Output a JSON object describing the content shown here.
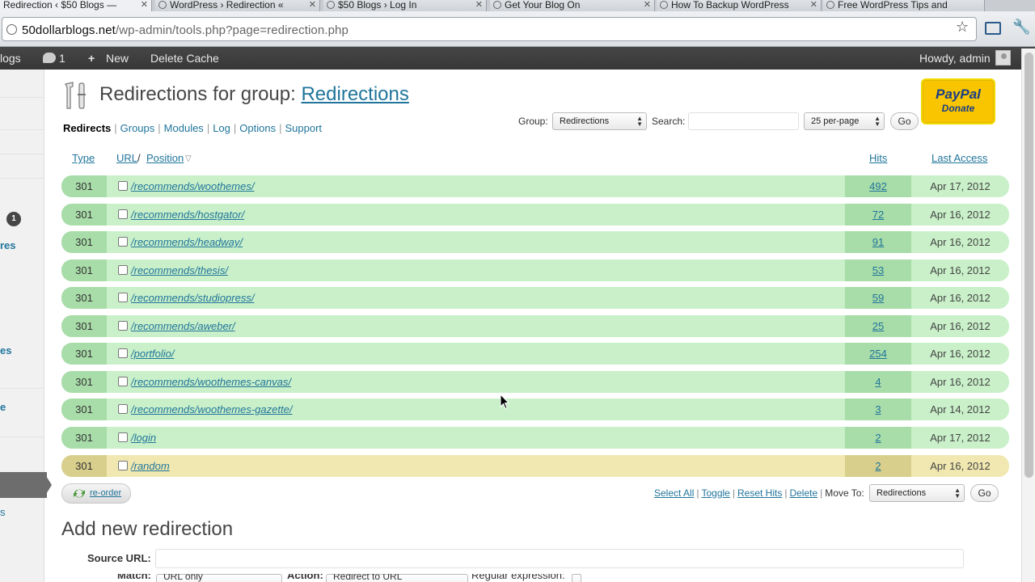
{
  "browser": {
    "tabs": [
      {
        "title": "Redirection ‹ $50 Blogs —",
        "active": true
      },
      {
        "title": "WordPress › Redirection «",
        "active": false
      },
      {
        "title": "$50 Blogs › Log In",
        "active": false
      },
      {
        "title": "Get Your Blog On",
        "active": false
      },
      {
        "title": "How To Backup WordPress",
        "active": false
      },
      {
        "title": "Free WordPress Tips and",
        "active": false
      }
    ],
    "url_host": "50dollarblogs.net",
    "url_path": "/wp-admin/tools.php?page=redirection.php"
  },
  "adminbar": {
    "site": "logs",
    "comments_count": "1",
    "new_label": "New",
    "delete_cache": "Delete Cache",
    "howdy": "Howdy, admin"
  },
  "sidebar": {
    "count_badge": "1",
    "fragments": [
      "res",
      "es",
      "e",
      "s"
    ]
  },
  "header": {
    "title_prefix": "Redirections for group: ",
    "title_link": "Redirections",
    "paypal_brand": "PayPal",
    "paypal_action": "Donate"
  },
  "subnav": {
    "current": "Redirects",
    "links": [
      "Groups",
      "Modules",
      "Log",
      "Options",
      "Support"
    ]
  },
  "filters": {
    "group_label": "Group:",
    "group_value": "Redirections",
    "search_label": "Search:",
    "search_value": "",
    "per_page_value": "25 per-page",
    "go_label": "Go"
  },
  "table": {
    "col_type": "Type",
    "col_url": "URL",
    "col_url_sep": " / ",
    "col_position": "Position",
    "col_hits": "Hits",
    "col_last": "Last Access",
    "rows": [
      {
        "type": "301",
        "url": "/recommends/woothemes/",
        "hits": "492",
        "last": "Apr 17, 2012"
      },
      {
        "type": "301",
        "url": "/recommends/hostgator/",
        "hits": "72",
        "last": "Apr 16, 2012"
      },
      {
        "type": "301",
        "url": "/recommends/headway/",
        "hits": "91",
        "last": "Apr 16, 2012"
      },
      {
        "type": "301",
        "url": "/recommends/thesis/",
        "hits": "53",
        "last": "Apr 16, 2012"
      },
      {
        "type": "301",
        "url": "/recommends/studiopress/",
        "hits": "59",
        "last": "Apr 16, 2012"
      },
      {
        "type": "301",
        "url": "/recommends/aweber/",
        "hits": "25",
        "last": "Apr 16, 2012"
      },
      {
        "type": "301",
        "url": "/portfolio/",
        "hits": "254",
        "last": "Apr 16, 2012"
      },
      {
        "type": "301",
        "url": "/recommends/woothemes-canvas/",
        "hits": "4",
        "last": "Apr 16, 2012"
      },
      {
        "type": "301",
        "url": "/recommends/woothemes-gazette/",
        "hits": "3",
        "last": "Apr 14, 2012"
      },
      {
        "type": "301",
        "url": "/login",
        "hits": "2",
        "last": "Apr 17, 2012"
      },
      {
        "type": "301",
        "url": "/random",
        "hits": "2",
        "last": "Apr 16, 2012"
      }
    ]
  },
  "bulk": {
    "reorder": "re-order",
    "select_all": "Select All",
    "toggle": "Toggle",
    "reset_hits": "Reset Hits",
    "delete": "Delete",
    "move_to": "Move To:",
    "move_value": "Redirections",
    "go_label": "Go"
  },
  "add_new": {
    "title": "Add new redirection",
    "source_label": "Source URL:",
    "source_value": "",
    "match_label": "Match:",
    "match_value": "URL only",
    "action_label": "Action:",
    "action_value": "Redirect to URL",
    "regex_label": "Regular expression:"
  },
  "colors": {
    "link": "#21759b",
    "row_green": "#c9f0c9",
    "row_green_dark": "#a8dca8",
    "row_yellow": "#f0e8b0",
    "adminbar": "#464646"
  }
}
